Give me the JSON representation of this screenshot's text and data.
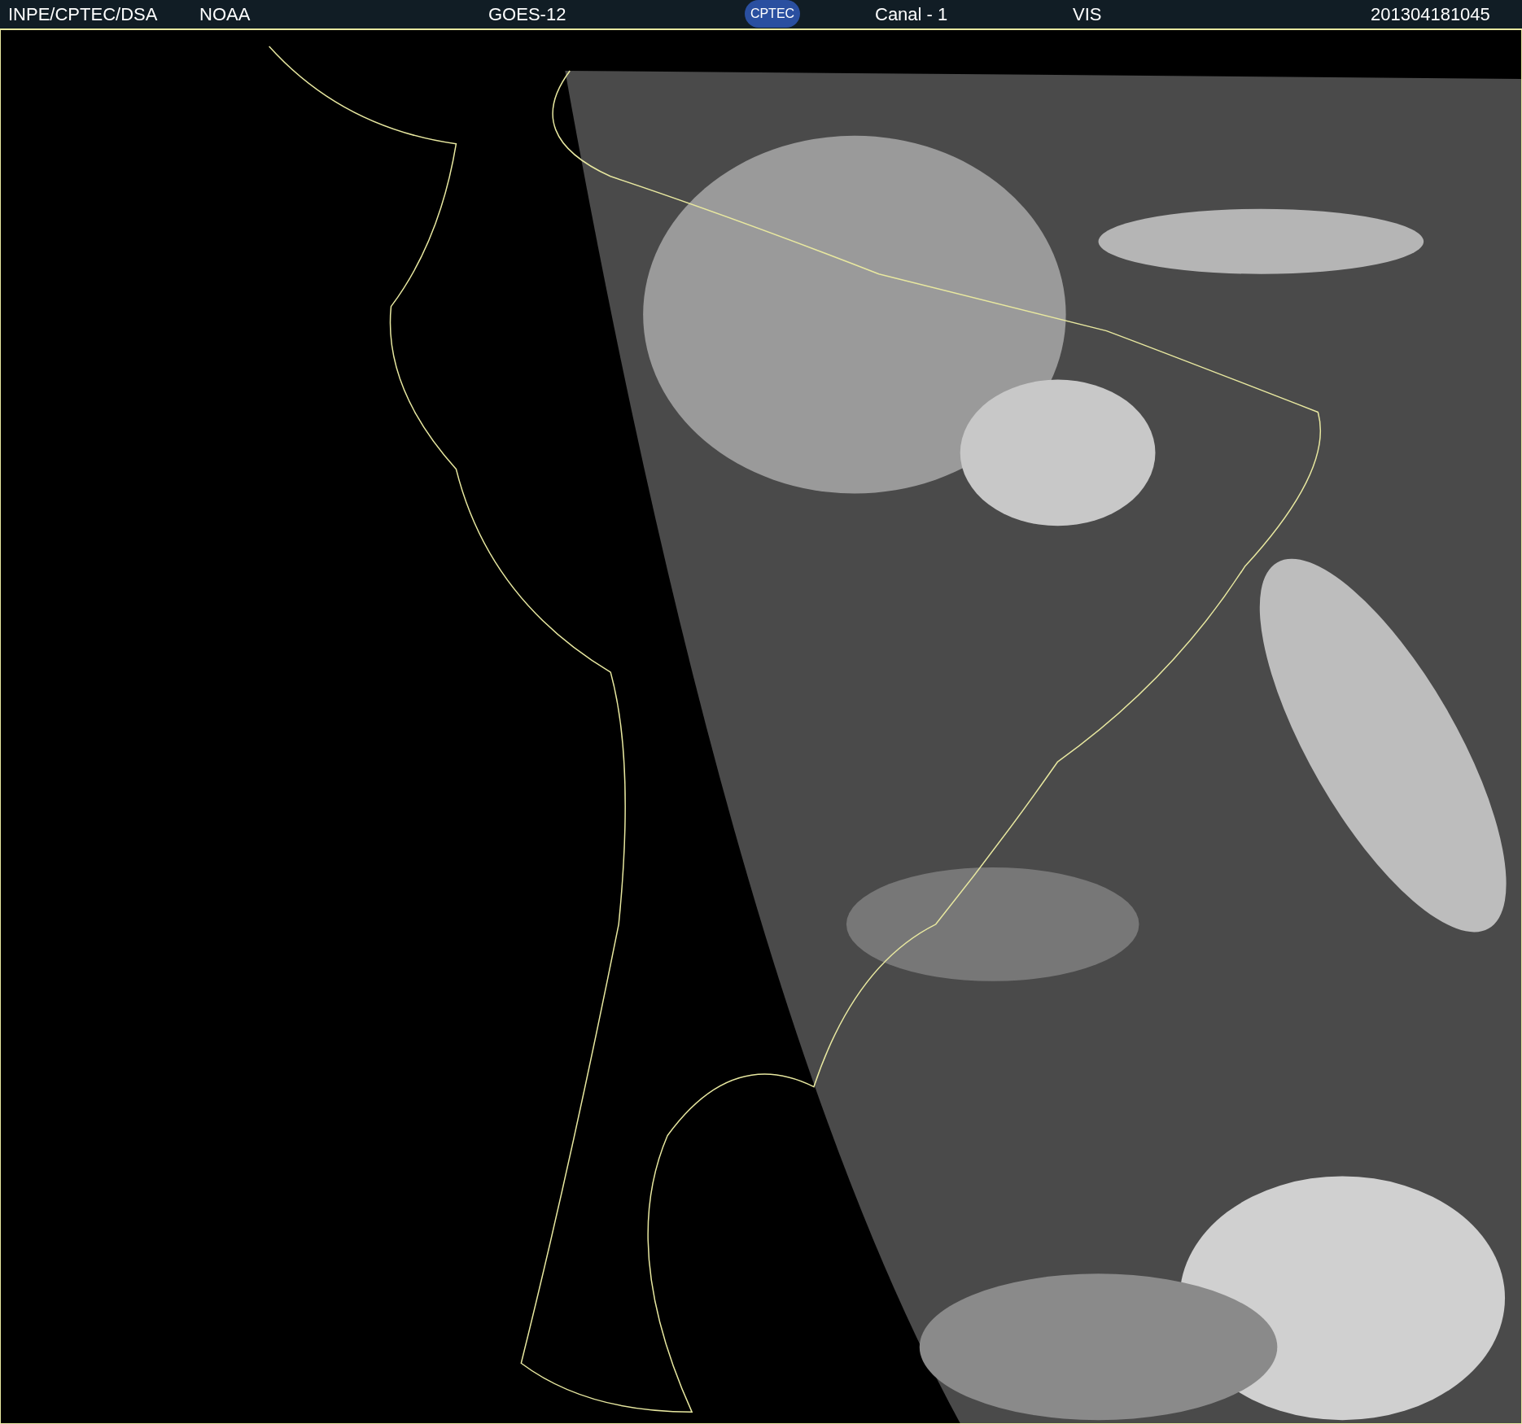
{
  "header": {
    "source": "INPE/CPTEC/DSA",
    "agency": "NOAA",
    "satellite": "GOES-12",
    "logo": "CPTEC",
    "channel": "Canal - 1",
    "band": "VIS",
    "timestamp": "201304181045"
  }
}
